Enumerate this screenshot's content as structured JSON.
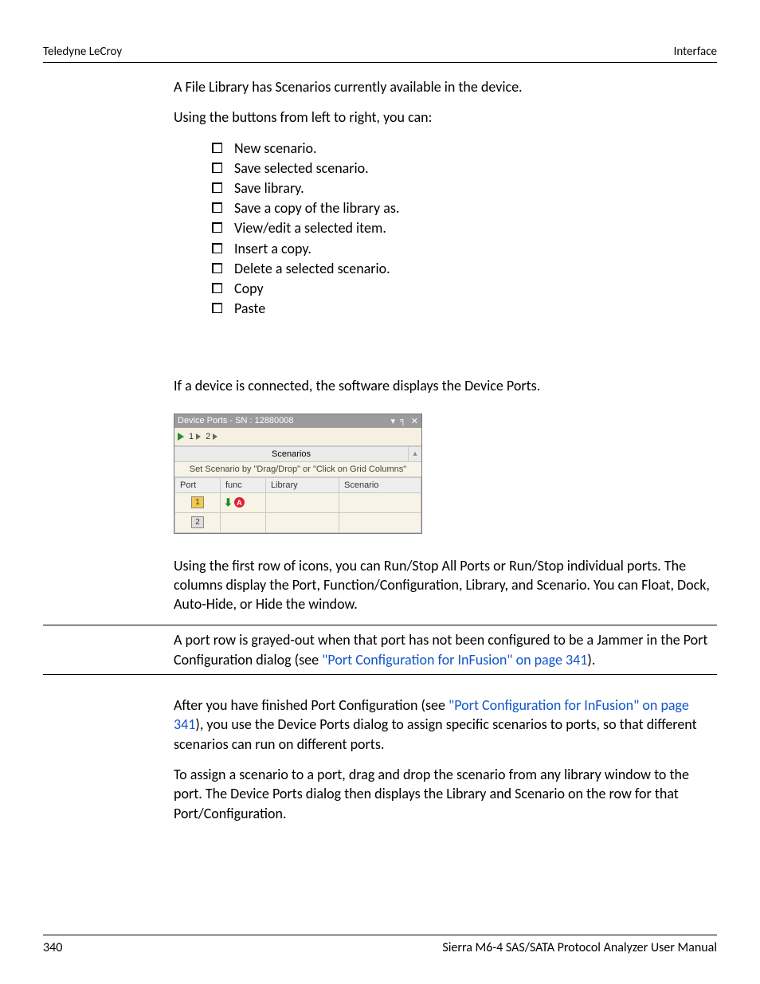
{
  "header": {
    "left": "Teledyne LeCroy",
    "right": "Interface"
  },
  "body": {
    "p1": "A File Library has Scenarios currently available in the device.",
    "p2": "Using the buttons from left to right, you can:",
    "bullets": [
      "New scenario.",
      "Save selected scenario.",
      "Save library.",
      "Save a copy of the library as.",
      "View/edit a selected item.",
      "Insert a copy.",
      "Delete a selected scenario.",
      "Copy",
      "Paste"
    ],
    "p3": "If a device is connected, the software displays the Device Ports.",
    "p4": "Using the first row of icons, you can Run/Stop All Ports or Run/Stop individual ports. The columns display the Port, Function/Configuration, Library, and Scenario. You can Float, Dock, Auto-Hide, or Hide the window.",
    "note_a": "A port row is grayed-out when that port has not been configured to be a Jammer in the Port Configuration dialog (see ",
    "note_link": "\"Port Configuration for InFusion\" on page 341",
    "note_b": ").",
    "p5a": "After you have finished Port Configuration (see ",
    "p5link": "\"Port Configuration for InFusion\" on page 341",
    "p5b": "), you use the Device Ports dialog to assign specific scenarios to ports, so that different scenarios can run on different ports.",
    "p6": "To assign a scenario to a port, drag and drop the scenario from any library window to the port. The Device Ports dialog then displays the Library and Scenario on the row for that Port/Configuration."
  },
  "screenshot": {
    "title": "Device Ports - SN : 12880008",
    "toolbar": {
      "port1": "1",
      "port2": "2"
    },
    "scenarios_header": "Scenarios",
    "hint": "Set Scenario by \"Drag/Drop\" or \"Click on Grid Columns\"",
    "columns": {
      "c1": "Port",
      "c2": "func",
      "c3": "Library",
      "c4": "Scenario"
    },
    "rows": [
      {
        "port": "1",
        "active": true,
        "func_badge": "A"
      },
      {
        "port": "2",
        "active": false
      }
    ]
  },
  "footer": {
    "page": "340",
    "title": "Sierra M6-4 SAS/SATA Protocol Analyzer User Manual"
  }
}
